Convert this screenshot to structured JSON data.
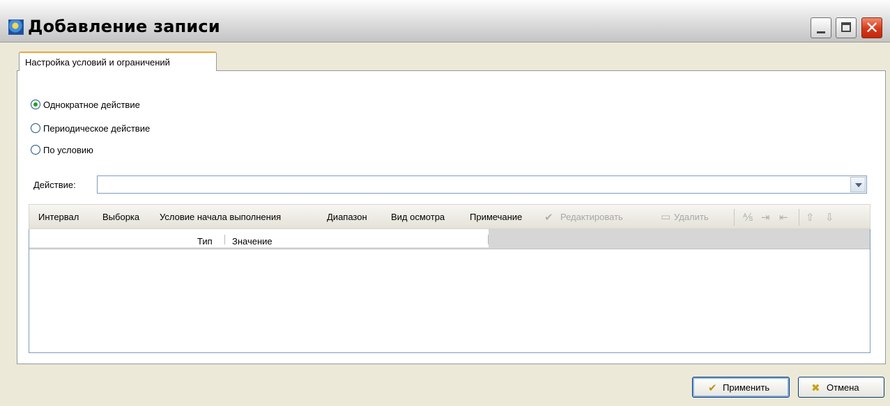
{
  "window": {
    "title": "Добавление записи"
  },
  "tabs": [
    {
      "label": "Настройка условий и ограничений",
      "active": true
    }
  ],
  "schedule_options": [
    {
      "label": "Однократное действие",
      "checked": true
    },
    {
      "label": "Периодическое действие",
      "checked": false
    },
    {
      "label": "По условию",
      "checked": false
    }
  ],
  "action": {
    "label": "Действие:",
    "value": ""
  },
  "toolbar": {
    "interval": "Интервал",
    "selection": "Выборка",
    "start_condition": "Условие начала выполнения",
    "range": "Диапазон",
    "inspection_type": "Вид осмотра",
    "note": "Примечание",
    "edit": "Редактировать",
    "delete": "Удалить"
  },
  "grid": {
    "columns": [
      "Тип",
      "Значение"
    ]
  },
  "buttons": {
    "apply": "Применить",
    "cancel": "Отмена"
  },
  "colors": {
    "tab_accent": "#f0a33a",
    "radio_checked": "#21a121",
    "close_button": "#d2391a"
  }
}
